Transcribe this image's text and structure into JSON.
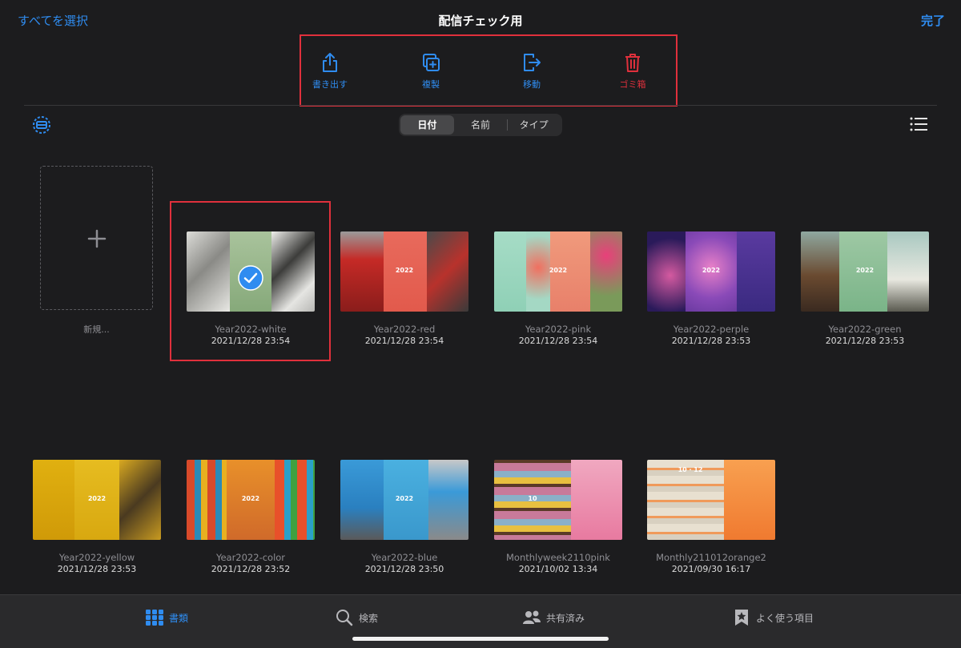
{
  "header": {
    "select_all": "すべてを選択",
    "title": "配信チェック用",
    "done": "完了"
  },
  "actions": {
    "export": "書き出す",
    "duplicate": "複製",
    "move": "移動",
    "trash": "ゴミ箱"
  },
  "sort": {
    "options": [
      "日付",
      "名前",
      "タイプ"
    ],
    "selected": "日付"
  },
  "new_doc": {
    "label": "新規..."
  },
  "documents": [
    {
      "name": "Year2022-white",
      "date": "2021/12/28 23:54",
      "year": "",
      "selected": true
    },
    {
      "name": "Year2022-red",
      "date": "2021/12/28 23:54",
      "year": "2022"
    },
    {
      "name": "Year2022-pink",
      "date": "2021/12/28 23:54",
      "year": "2022"
    },
    {
      "name": "Year2022-perple",
      "date": "2021/12/28 23:53",
      "year": "2022"
    },
    {
      "name": "Year2022-green",
      "date": "2021/12/28 23:53",
      "year": "2022"
    },
    {
      "name": "Year2022-yellow",
      "date": "2021/12/28 23:53",
      "year": "2022"
    },
    {
      "name": "Year2022-color",
      "date": "2021/12/28 23:52",
      "year": "2022"
    },
    {
      "name": "Year2022-blue",
      "date": "2021/12/28 23:50",
      "year": "2022"
    },
    {
      "name": "Monthlyweek2110pink",
      "date": "2021/10/02 13:34",
      "year": "10"
    },
    {
      "name": "Monthly211012orange2",
      "date": "2021/09/30 16:17",
      "year": "10 · 12"
    }
  ],
  "tabs": {
    "documents": "書類",
    "search": "検索",
    "shared": "共有済み",
    "favorites": "よく使う項目"
  },
  "colors": {
    "accent": "#2f8cf0",
    "danger": "#e0303c",
    "background": "#1c1c1e"
  }
}
